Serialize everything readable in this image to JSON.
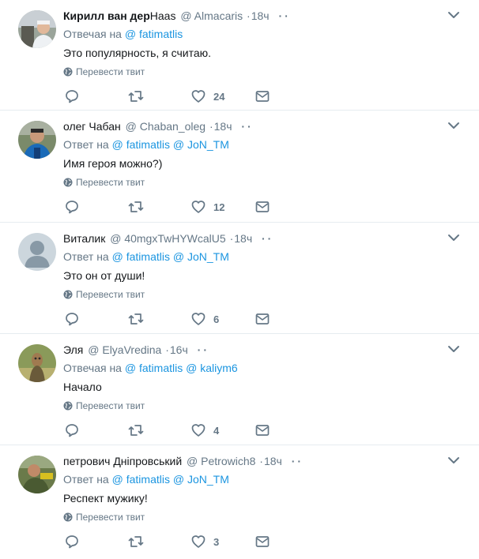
{
  "colors": {
    "link": "#1b95e0",
    "muted": "#657786",
    "text": "#14171a",
    "divider": "#e6ecf0"
  },
  "icons": {
    "reply": "reply-icon",
    "retweet": "retweet-icon",
    "like": "heart-icon",
    "dm": "envelope-icon",
    "translate": "globe-icon",
    "menu": "chevron-down-icon"
  },
  "translate_label": "Перевести твит",
  "tweets": [
    {
      "fullname": "Кирилл ван дер",
      "fullname_suffix": "Haas",
      "screenname": "@ Almacaris",
      "time": "18ч",
      "reply_prefix": "Отвечая на",
      "mention1": "@ fatimatlis",
      "mention2": "",
      "text": "Это популярность, я считаю.",
      "likes": "24"
    },
    {
      "fullname": "олег Чабан",
      "fullname_suffix": "",
      "screenname": "@ Chaban_oleg",
      "time": "18ч",
      "reply_prefix": "Ответ на",
      "mention1": "@ fatimatlis",
      "mention2": "@ JoN_TM",
      "text": "Имя героя можно?)",
      "likes": "12"
    },
    {
      "fullname": "Виталик",
      "fullname_suffix": "",
      "screenname": "@ 40mgxTwHYWcalU5",
      "time": "18ч",
      "reply_prefix": "Ответ на",
      "mention1": "@ fatimatlis",
      "mention2": "@ JoN_TM",
      "text": "Это он от души!",
      "likes": "6"
    },
    {
      "fullname": "Эля",
      "fullname_suffix": "",
      "screenname": "@ ElyaVredina",
      "time": "16ч",
      "reply_prefix": "Отвечая на",
      "mention1": "@ fatimatlis",
      "mention2": "@ kaliym6",
      "text": "Начало",
      "likes": "4"
    },
    {
      "fullname": "петрович Дніпровський",
      "fullname_suffix": "",
      "screenname": "@ Petrowich8",
      "time": "18ч",
      "reply_prefix": "Ответ на",
      "mention1": "@ fatimatlis",
      "mention2": "@ JoN_TM",
      "text": "Респект мужику!",
      "likes": "3"
    }
  ]
}
